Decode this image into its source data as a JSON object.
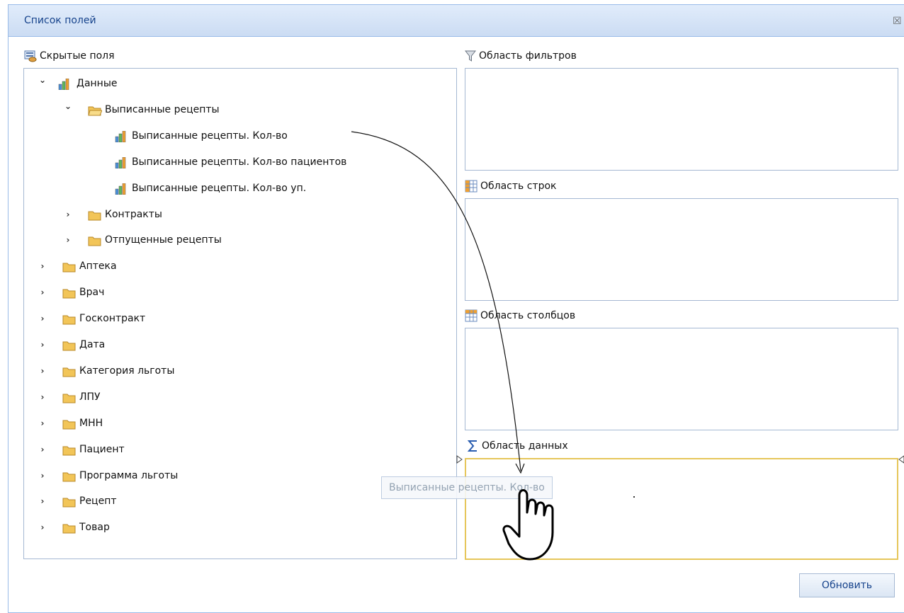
{
  "dialog": {
    "title": "Список полей",
    "close_glyph": "☒"
  },
  "hidden_fields": {
    "label": "Скрытые поля",
    "tree": [
      {
        "label": "Данные",
        "expanded": true,
        "type": "measure-group",
        "level": 0
      },
      {
        "label": "Выписанные рецепты",
        "expanded": true,
        "type": "folder-open",
        "level": 1
      },
      {
        "label": "Выписанные рецепты. Кол-во",
        "type": "measure",
        "level": 2
      },
      {
        "label": "Выписанные рецепты. Кол-во пациентов",
        "type": "measure",
        "level": 2
      },
      {
        "label": "Выписанные рецепты. Кол-во уп.",
        "type": "measure",
        "level": 2
      },
      {
        "label": "Контракты",
        "expanded": false,
        "type": "folder",
        "level": 1
      },
      {
        "label": "Отпущенные рецепты",
        "expanded": false,
        "type": "folder",
        "level": 1
      },
      {
        "label": "Аптека",
        "expanded": false,
        "type": "folder",
        "level": 0
      },
      {
        "label": "Врач",
        "expanded": false,
        "type": "folder",
        "level": 0
      },
      {
        "label": "Госконтракт",
        "expanded": false,
        "type": "folder",
        "level": 0
      },
      {
        "label": "Дата",
        "expanded": false,
        "type": "folder",
        "level": 0
      },
      {
        "label": "Категория льготы",
        "expanded": false,
        "type": "folder",
        "level": 0
      },
      {
        "label": "ЛПУ",
        "expanded": false,
        "type": "folder",
        "level": 0
      },
      {
        "label": "МНН",
        "expanded": false,
        "type": "folder",
        "level": 0
      },
      {
        "label": "Пациент",
        "expanded": false,
        "type": "folder",
        "level": 0
      },
      {
        "label": "Программа льготы",
        "expanded": false,
        "type": "folder",
        "level": 0
      },
      {
        "label": "Рецепт",
        "expanded": false,
        "type": "folder",
        "level": 0
      },
      {
        "label": "Товар",
        "expanded": false,
        "type": "folder",
        "level": 0
      }
    ]
  },
  "areas": {
    "filters": {
      "label": "Область фильтров",
      "icon": "funnel-icon"
    },
    "rows": {
      "label": "Область строк",
      "icon": "rows-grid-icon"
    },
    "columns": {
      "label": "Область столбцов",
      "icon": "columns-grid-icon"
    },
    "data": {
      "label": "Область данных",
      "icon": "sigma-icon"
    }
  },
  "drag": {
    "label": "Выписанные рецепты. Кол-во"
  },
  "buttons": {
    "update": "Обновить"
  },
  "colors": {
    "title_bar": "#cbdcf3",
    "panel_border": "#a5b8d3",
    "active_drop_border": "#e6c65a",
    "folder": "#f2c558"
  }
}
